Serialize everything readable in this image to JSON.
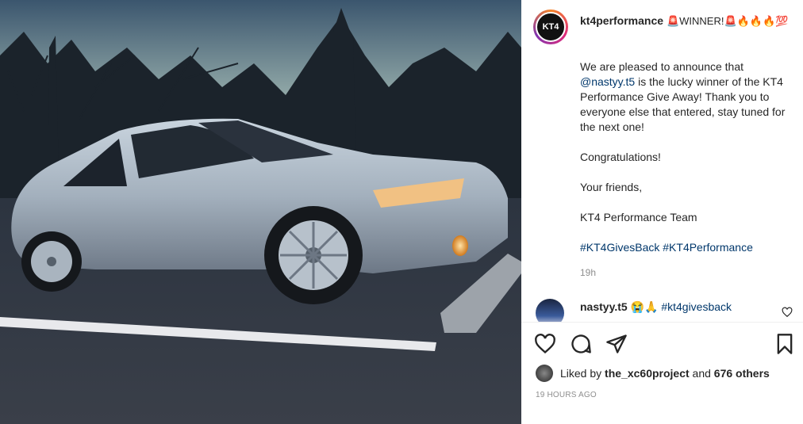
{
  "post": {
    "author": "kt4performance",
    "avatar_text": "KT4",
    "title_line": "🚨WINNER!🚨🔥🔥🔥💯",
    "caption_intro": "We are pleased to announce that ",
    "caption_mention": "@nastyy.t5",
    "caption_rest": " is the lucky winner of the KT4 Performance Give Away! Thank you to everyone else that entered, stay tuned for the next one!\n\nCongratulations!\n\nYour friends,\n\nKT4 Performance Team\n\n",
    "caption_hashtags": "#KT4GivesBack #KT4Performance",
    "age": "19h"
  },
  "comment": {
    "user": "nastyy.t5",
    "emoji": "😭🙏",
    "hashtag": "#kt4givesback"
  },
  "likes": {
    "prefix": "Liked by ",
    "user": "the_xc60project",
    "middle": " and ",
    "count": "676 others"
  },
  "timestamp": "19 HOURS AGO",
  "icons": [
    "heart-icon",
    "comment-icon",
    "share-icon",
    "bookmark-icon"
  ]
}
